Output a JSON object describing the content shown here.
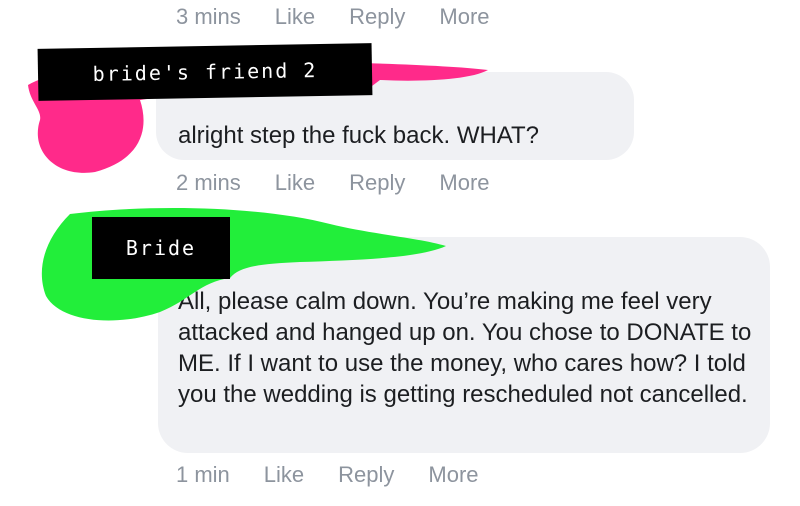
{
  "comments": [
    {
      "author": "bride's friend 2",
      "text": "alright step the fuck back. WHAT?",
      "time": "2 mins",
      "actions": [
        "Like",
        "Reply",
        "More"
      ],
      "scribble_color": "#ff2a8a"
    },
    {
      "author": "Bride",
      "text": "All, please calm down. You’re making me feel very attacked and hanged up on. You chose to DONATE to ME. If I want to use the money, who cares how? I told you the wedding is getting rescheduled not cancelled.",
      "time": "1 min",
      "actions": [
        "Like",
        "Reply",
        "More"
      ],
      "scribble_color": "#22ee3a"
    }
  ],
  "previous_comment": {
    "time": "3 mins",
    "actions": [
      "Like",
      "Reply",
      "More"
    ]
  },
  "colors": {
    "bubble_background": "#f0f1f4",
    "meta_text": "#8d949e",
    "body_text": "#1c1e21"
  }
}
